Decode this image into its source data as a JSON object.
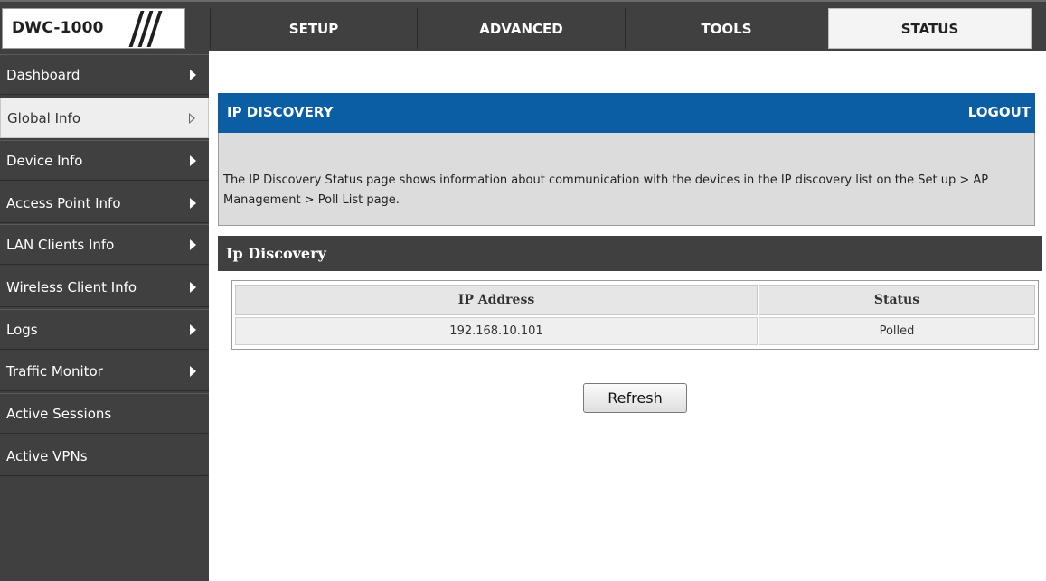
{
  "brand": {
    "model": "DWC-1000"
  },
  "tabs": [
    {
      "label": "SETUP",
      "active": false
    },
    {
      "label": "ADVANCED",
      "active": false
    },
    {
      "label": "TOOLS",
      "active": false
    },
    {
      "label": "STATUS",
      "active": true
    }
  ],
  "sidebar": {
    "items": [
      {
        "label": "Dashboard",
        "icon": "triangle-right-icon"
      },
      {
        "label": "Global Info",
        "icon": "triangle-right-outline-icon",
        "active": true
      },
      {
        "label": "Device Info",
        "icon": "triangle-right-icon"
      },
      {
        "label": "Access Point Info",
        "icon": "triangle-right-icon"
      },
      {
        "label": "LAN Clients Info",
        "icon": "triangle-right-icon"
      },
      {
        "label": "Wireless Client Info",
        "icon": "triangle-right-icon"
      },
      {
        "label": "Logs",
        "icon": "triangle-right-icon"
      },
      {
        "label": "Traffic Monitor",
        "icon": "triangle-right-icon"
      },
      {
        "label": "Active Sessions"
      },
      {
        "label": "Active VPNs"
      }
    ]
  },
  "panel": {
    "title": "IP DISCOVERY",
    "logout_label": "LOGOUT",
    "description": "The IP Discovery Status page shows information about communication with the devices in the IP discovery list on the Set up > AP Management > Poll List page."
  },
  "section": {
    "title": "Ip Discovery",
    "table": {
      "columns": [
        "IP Address",
        "Status"
      ],
      "rows": [
        [
          "192.168.10.101",
          "Polled"
        ]
      ]
    }
  },
  "refresh_label": "Refresh",
  "colors": {
    "header_blue": "#0b5ea4",
    "dark_bar": "#404040",
    "panel_gray": "#dcdcdc"
  }
}
